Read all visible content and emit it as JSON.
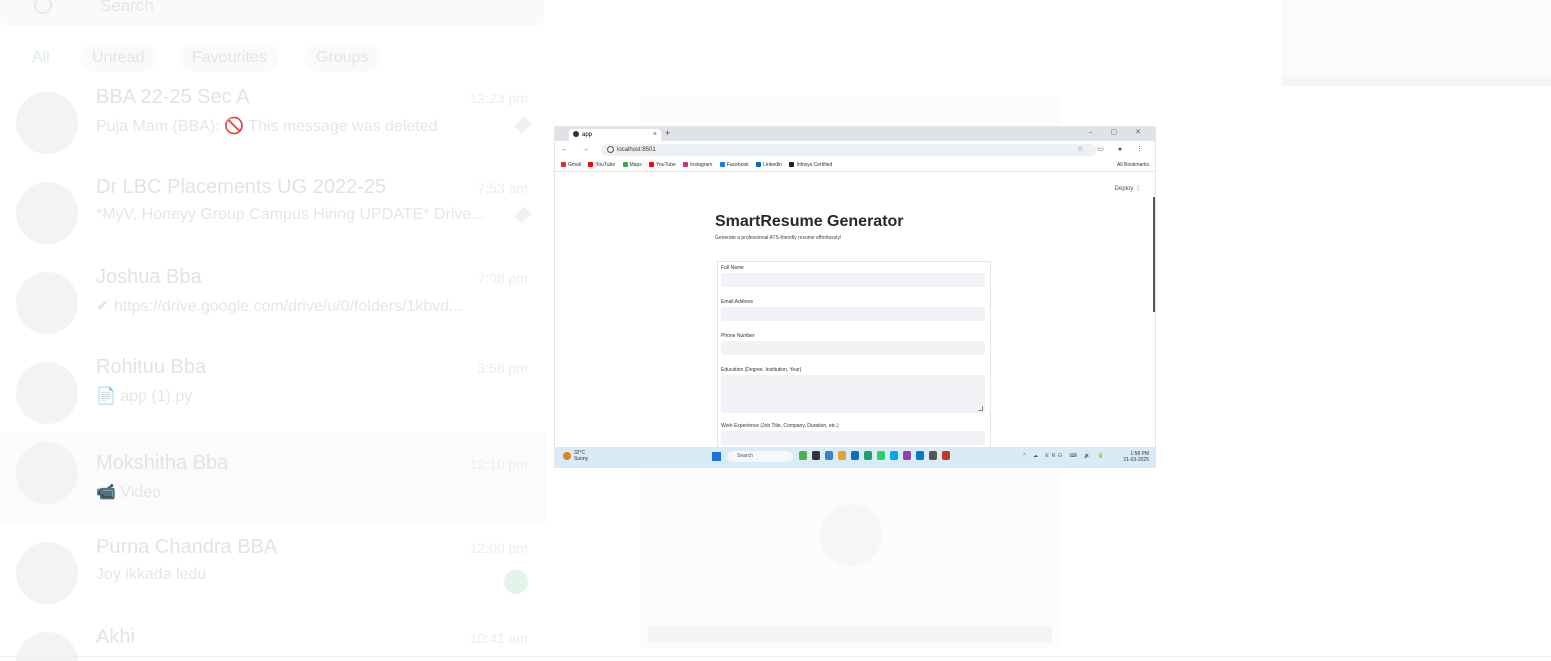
{
  "background_app": {
    "search_placeholder": "Search",
    "filters": [
      "All",
      "Unread",
      "Favourites",
      "Groups"
    ],
    "chats": [
      {
        "name": "BBA 22-25 Sec A",
        "time": "12:23 pm",
        "preview": "Puja Mam (BBA): 🚫 This message was deleted"
      },
      {
        "name": "Dr LBC Placements UG 2022-25",
        "time": "7:53 am",
        "preview": "*MyV, Honeyy Group Campus Hiring UPDATE* Drive..."
      },
      {
        "name": "Joshua Bba",
        "time": "7:08 pm",
        "preview": "✔ https://drive.google.com/drive/u/0/folders/1kbvd..."
      },
      {
        "name": "Rohituu Bba",
        "time": "3:58 pm",
        "preview": "📄 app (1).py"
      },
      {
        "name": "Mokshitha Bba",
        "time": "12:10 pm",
        "preview": "📹 Video"
      },
      {
        "name": "Purna Chandra BBA",
        "time": "12:00 pm",
        "preview": "Joy ikkada ledu"
      },
      {
        "name": "Akhi",
        "time": "10:41 am",
        "preview": ""
      }
    ]
  },
  "browser": {
    "tab_label": "app",
    "url": "localhost:8501",
    "bookmarks": [
      {
        "label": "Gmail",
        "color": "#d93025"
      },
      {
        "label": "YouTube",
        "color": "#ff0000"
      },
      {
        "label": "Maps",
        "color": "#34a853"
      },
      {
        "label": "YouTube",
        "color": "#ff0000"
      },
      {
        "label": "Instagram",
        "color": "#c13584"
      },
      {
        "label": "Facebook",
        "color": "#1877f2"
      },
      {
        "label": "LinkedIn",
        "color": "#0a66c2"
      },
      {
        "label": "Infosys Certified",
        "color": "#222222"
      }
    ],
    "all_bookmarks_label": "All Bookmarks",
    "deploy_label": "Deploy ⋮"
  },
  "app": {
    "title": "SmartResume Generator",
    "subtitle": "Generate a professional ATS-friendly resume effortlessly!",
    "fields": [
      {
        "label": "Full Name",
        "kind": "input"
      },
      {
        "label": "Email Address",
        "kind": "input"
      },
      {
        "label": "Phone Number",
        "kind": "input"
      },
      {
        "label": "Education (Degree, Institution, Year)",
        "kind": "textarea"
      },
      {
        "label": "Work Experience (Job Title, Company, Duration, etc.)",
        "kind": "input"
      }
    ]
  },
  "taskbar": {
    "weather_temp": "32°C",
    "weather_desc": "Sunny",
    "search_label": "Search",
    "app_icon_colors": [
      "#4caf50",
      "#333333",
      "#3b82c4",
      "#e2a13a",
      "#0f6cbd",
      "#20a06a",
      "#25d366",
      "#00a4ef",
      "#8e44ad",
      "#007acc",
      "#555555",
      "#c0392b"
    ],
    "tray_icons": "^ ☁ ENG ⌨ 🔊 🔋",
    "time": "1:58 PM",
    "date": "21-03-2025"
  }
}
